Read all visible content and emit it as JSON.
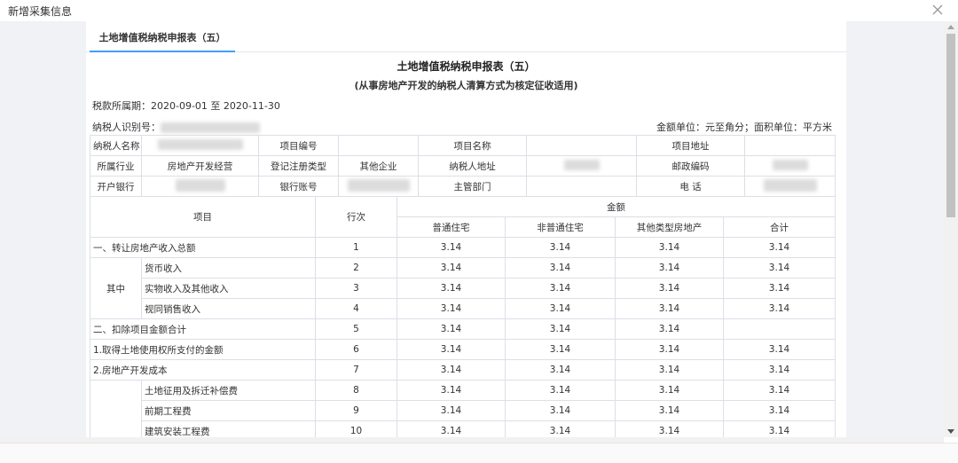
{
  "dialog": {
    "title": "新增采集信息",
    "close_icon": "close-icon"
  },
  "tab": {
    "label": "土地增值税纳税申报表（五）"
  },
  "report": {
    "title": "土地增值税纳税申报表（五）",
    "subtitle": "(从事房地产开发的纳税人清算方式为核定征收适用)",
    "period": "税款所属期：2020-09-01 至 2020-11-30",
    "taxid_label": "纳税人识别号：",
    "units": "金额单位：元至角分；面积单位：平方米"
  },
  "info": {
    "r1": [
      "纳税人名称",
      "项目编号",
      "项目名称",
      "项目地址"
    ],
    "r2": [
      "所属行业",
      "房地产开发经营",
      "登记注册类型",
      "其他企业",
      "纳税人地址",
      "邮政编码"
    ],
    "r3": [
      "开户银行",
      "银行账号",
      "主管部门",
      "电 话"
    ]
  },
  "main": {
    "header_item": "项目",
    "header_row": "行次",
    "header_amount": "金额",
    "cols": [
      "普通住宅",
      "非普通住宅",
      "其他类型房地产",
      "合计"
    ],
    "qizhong": "其中",
    "rows": [
      {
        "label": "一、转让房地产收入总额",
        "no": "1",
        "v": [
          "3.14",
          "3.14",
          "3.14",
          "3.14"
        ]
      },
      {
        "label": "货币收入",
        "no": "2",
        "v": [
          "3.14",
          "3.14",
          "3.14",
          "3.14"
        ]
      },
      {
        "label": "实物收入及其他收入",
        "no": "3",
        "v": [
          "3.14",
          "3.14",
          "3.14",
          "3.14"
        ]
      },
      {
        "label": "视同销售收入",
        "no": "4",
        "v": [
          "3.14",
          "3.14",
          "3.14",
          "3.14"
        ]
      },
      {
        "label": "二、扣除项目金额合计",
        "no": "5",
        "v": [
          "3.14",
          "3.14",
          "3.14",
          ""
        ]
      },
      {
        "label": "1.取得土地使用权所支付的金额",
        "no": "6",
        "v": [
          "3.14",
          "3.14",
          "3.14",
          "3.14"
        ]
      },
      {
        "label": "2.房地产开发成本",
        "no": "7",
        "v": [
          "3.14",
          "3.14",
          "3.14",
          "3.14"
        ]
      },
      {
        "label": "土地征用及拆迁补偿费",
        "no": "8",
        "v": [
          "3.14",
          "3.14",
          "3.14",
          "3.14"
        ]
      },
      {
        "label": "前期工程费",
        "no": "9",
        "v": [
          "3.14",
          "3.14",
          "3.14",
          "3.14"
        ]
      },
      {
        "label": "建筑安装工程费",
        "no": "10",
        "v": [
          "3.14",
          "3.14",
          "3.14",
          "3.14"
        ]
      }
    ]
  }
}
